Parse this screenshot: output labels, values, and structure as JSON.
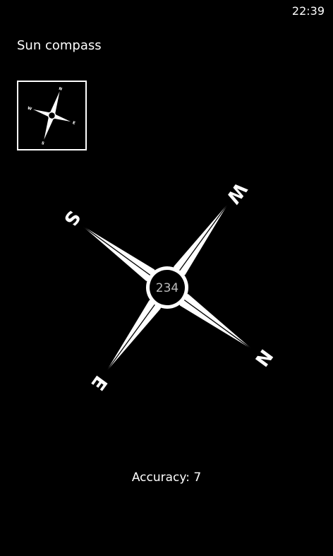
{
  "status_bar": {
    "time": "22:39"
  },
  "app": {
    "title": "Sun compass"
  },
  "compass": {
    "heading": "234",
    "rotation_deg": 36,
    "north_label": "N",
    "south_label": "S",
    "east_label": "E",
    "west_label": "W"
  },
  "mini_compass": {
    "rotation_deg": 18,
    "north_label": "N",
    "south_label": "S",
    "east_label": "E",
    "west_label": "W"
  },
  "accuracy": {
    "text": "Accuracy: 7"
  },
  "colors": {
    "background": "#000000",
    "foreground": "#ffffff"
  }
}
